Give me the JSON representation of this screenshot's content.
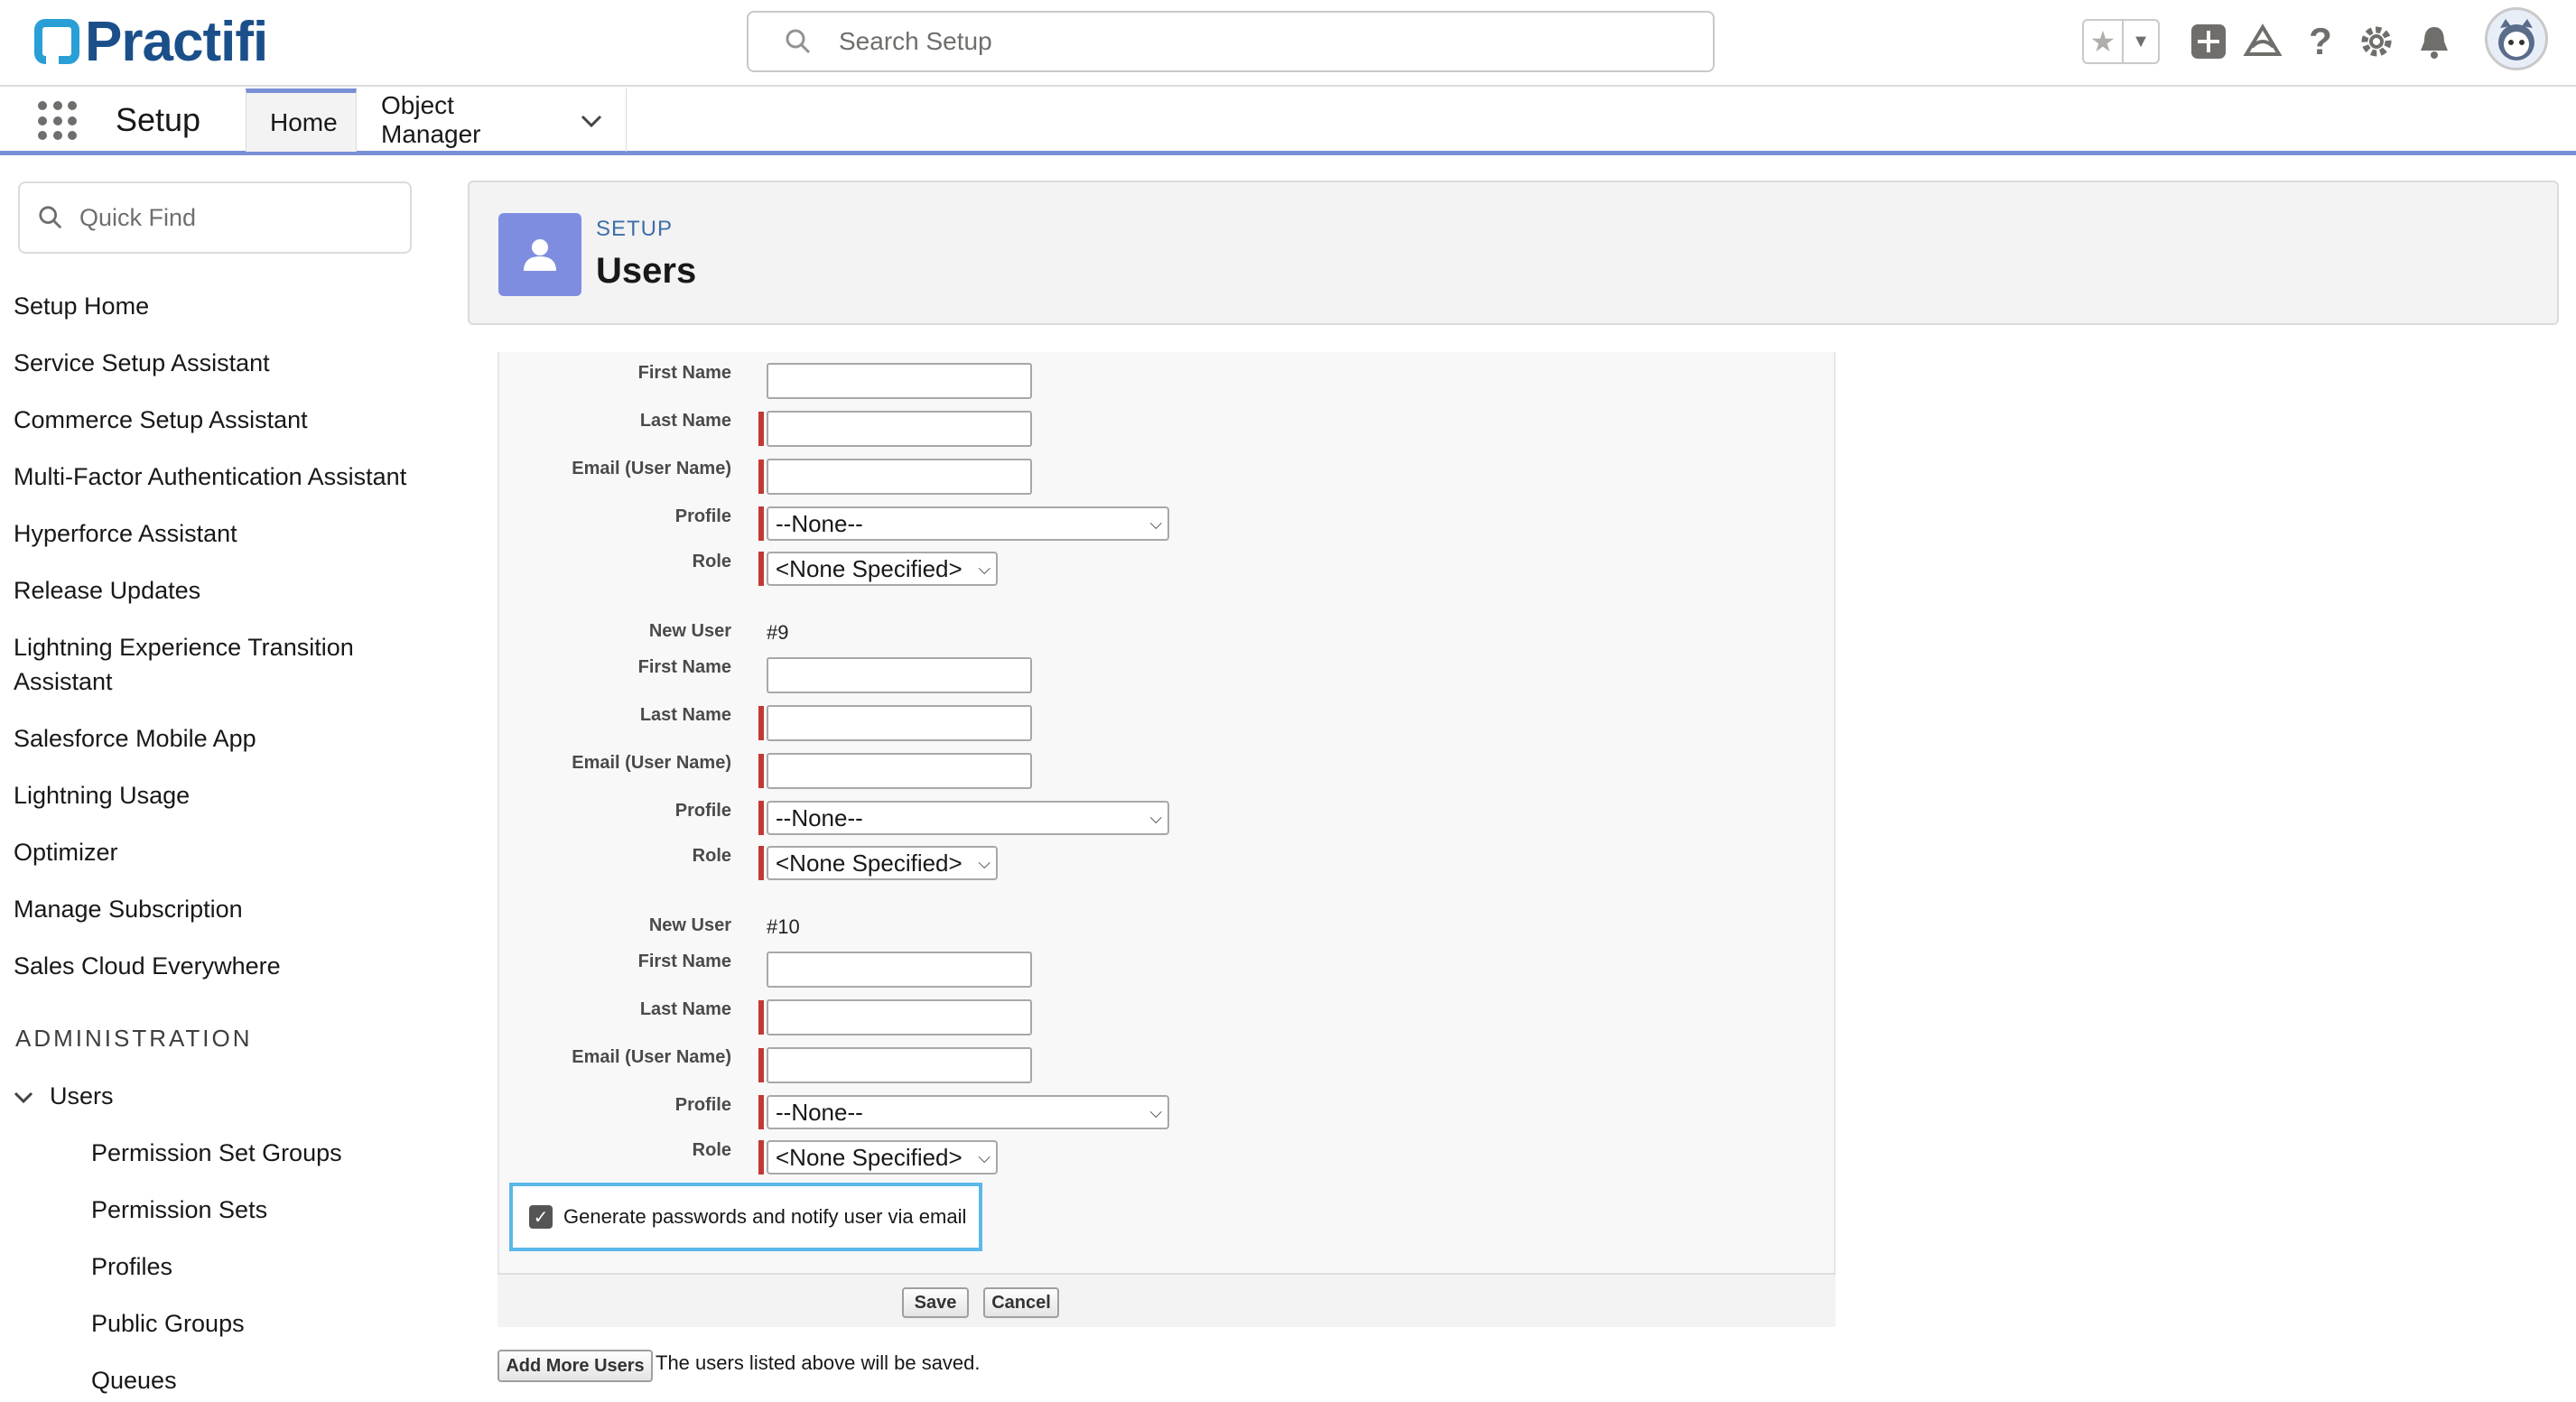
{
  "header": {
    "logo_text": "Practifi",
    "search_placeholder": "Search Setup"
  },
  "nav": {
    "app_title": "Setup",
    "tabs": [
      {
        "label": "Home"
      },
      {
        "label": "Object Manager"
      }
    ]
  },
  "sidebar": {
    "quick_find_placeholder": "Quick Find",
    "items": [
      "Setup Home",
      "Service Setup Assistant",
      "Commerce Setup Assistant",
      "Multi-Factor Authentication Assistant",
      "Hyperforce Assistant",
      "Release Updates",
      "Lightning Experience Transition Assistant",
      "Salesforce Mobile App",
      "Lightning Usage",
      "Optimizer",
      "Manage Subscription",
      "Sales Cloud Everywhere"
    ],
    "section_heading": "ADMINISTRATION",
    "users_label": "Users",
    "sub_items": [
      "Permission Set Groups",
      "Permission Sets",
      "Profiles",
      "Public Groups",
      "Queues"
    ]
  },
  "page_header": {
    "kicker": "SETUP",
    "title": "Users"
  },
  "form": {
    "labels": {
      "first_name": "First Name",
      "last_name": "Last Name",
      "email": "Email (User Name)",
      "profile": "Profile",
      "role": "Role",
      "new_user": "New User"
    },
    "profile_value": "--None--",
    "role_value": "<None Specified>",
    "user9": "#9",
    "user10": "#10",
    "generate_passwords_label": "Generate passwords and notify user via email",
    "save_label": "Save",
    "cancel_label": "Cancel",
    "add_more_label": "Add More Users",
    "note_text": "The users listed above will be saved."
  },
  "colors": {
    "accent": "#7a8fd6",
    "required": "#c23934",
    "highlight": "#5bb8e8",
    "logo": "#1b4f8a"
  }
}
